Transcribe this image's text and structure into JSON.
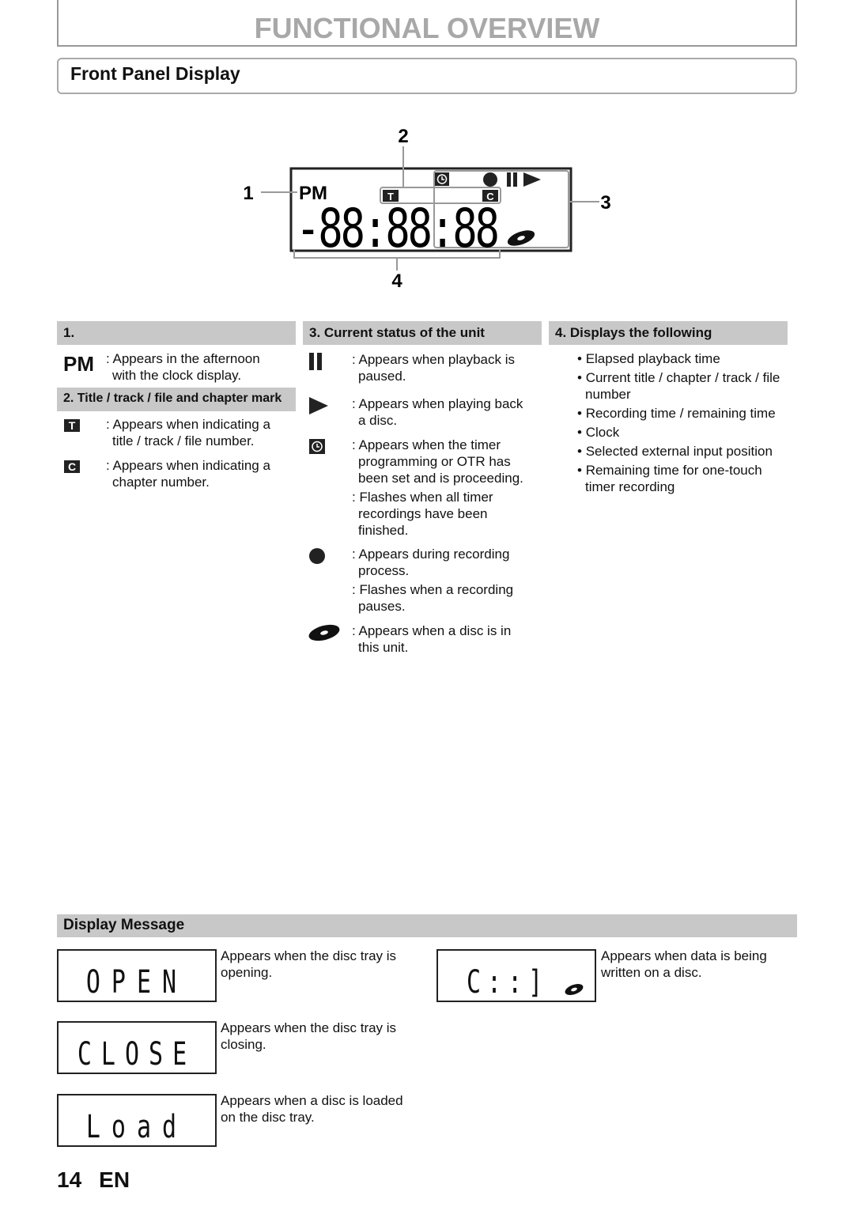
{
  "header": {
    "title": "FUNCTIONAL OVERVIEW"
  },
  "section": {
    "title": "Front Panel Display"
  },
  "diagram": {
    "callouts": [
      "1",
      "2",
      "3",
      "4"
    ],
    "pm": "PM",
    "t_mark": "T",
    "c_mark": "C",
    "digits": "-88:88:88"
  },
  "col1": {
    "header": "1.",
    "pm_label": "PM",
    "pm_text": [
      ": Appears in the afternoon",
      "with the clock display."
    ],
    "sub_header": "2. Title / track / file and chapter mark",
    "t_label": "T",
    "t_text": [
      ": Appears when indicating a",
      "title / track / file number."
    ],
    "c_label": "C",
    "c_text": [
      ": Appears when indicating a",
      "chapter number."
    ]
  },
  "col2": {
    "header": "3. Current status of the unit",
    "items": [
      {
        "icon": "pause-icon",
        "lines": [
          ": Appears when playback is",
          "paused."
        ]
      },
      {
        "icon": "play-icon",
        "lines": [
          ": Appears when playing back",
          "a disc."
        ]
      },
      {
        "icon": "timer-icon",
        "lines": [
          ": Appears when the timer",
          "programming or OTR has",
          "been set and is proceeding.",
          ": Flashes when all timer",
          "recordings have been",
          "finished."
        ]
      },
      {
        "icon": "record-icon",
        "lines": [
          ": Appears during recording",
          "process.",
          ": Flashes when a recording",
          "pauses."
        ]
      },
      {
        "icon": "disc-icon",
        "lines": [
          ": Appears when a disc is in",
          "this unit."
        ]
      }
    ]
  },
  "col3": {
    "header": "4. Displays the following",
    "items": [
      "Elapsed playback time",
      "Current title / chapter / track / file number",
      "Recording time / remaining time",
      "Clock",
      "Selected external input position",
      "Remaining time for one-touch timer recording"
    ]
  },
  "display_message": {
    "header": "Display Message",
    "items": [
      {
        "display": "OPEN",
        "lines": [
          "Appears when the disc tray is",
          "opening."
        ]
      },
      {
        "display": "CLOSE",
        "lines": [
          "Appears when the disc tray is",
          "closing."
        ]
      },
      {
        "display": "Load",
        "lines": [
          "Appears when a disc is loaded",
          "on the disc tray."
        ]
      },
      {
        "display": "C::]",
        "lines": [
          "Appears when data is being",
          "written on a disc."
        ]
      }
    ]
  },
  "footer": {
    "page": "14",
    "lang": "EN"
  }
}
